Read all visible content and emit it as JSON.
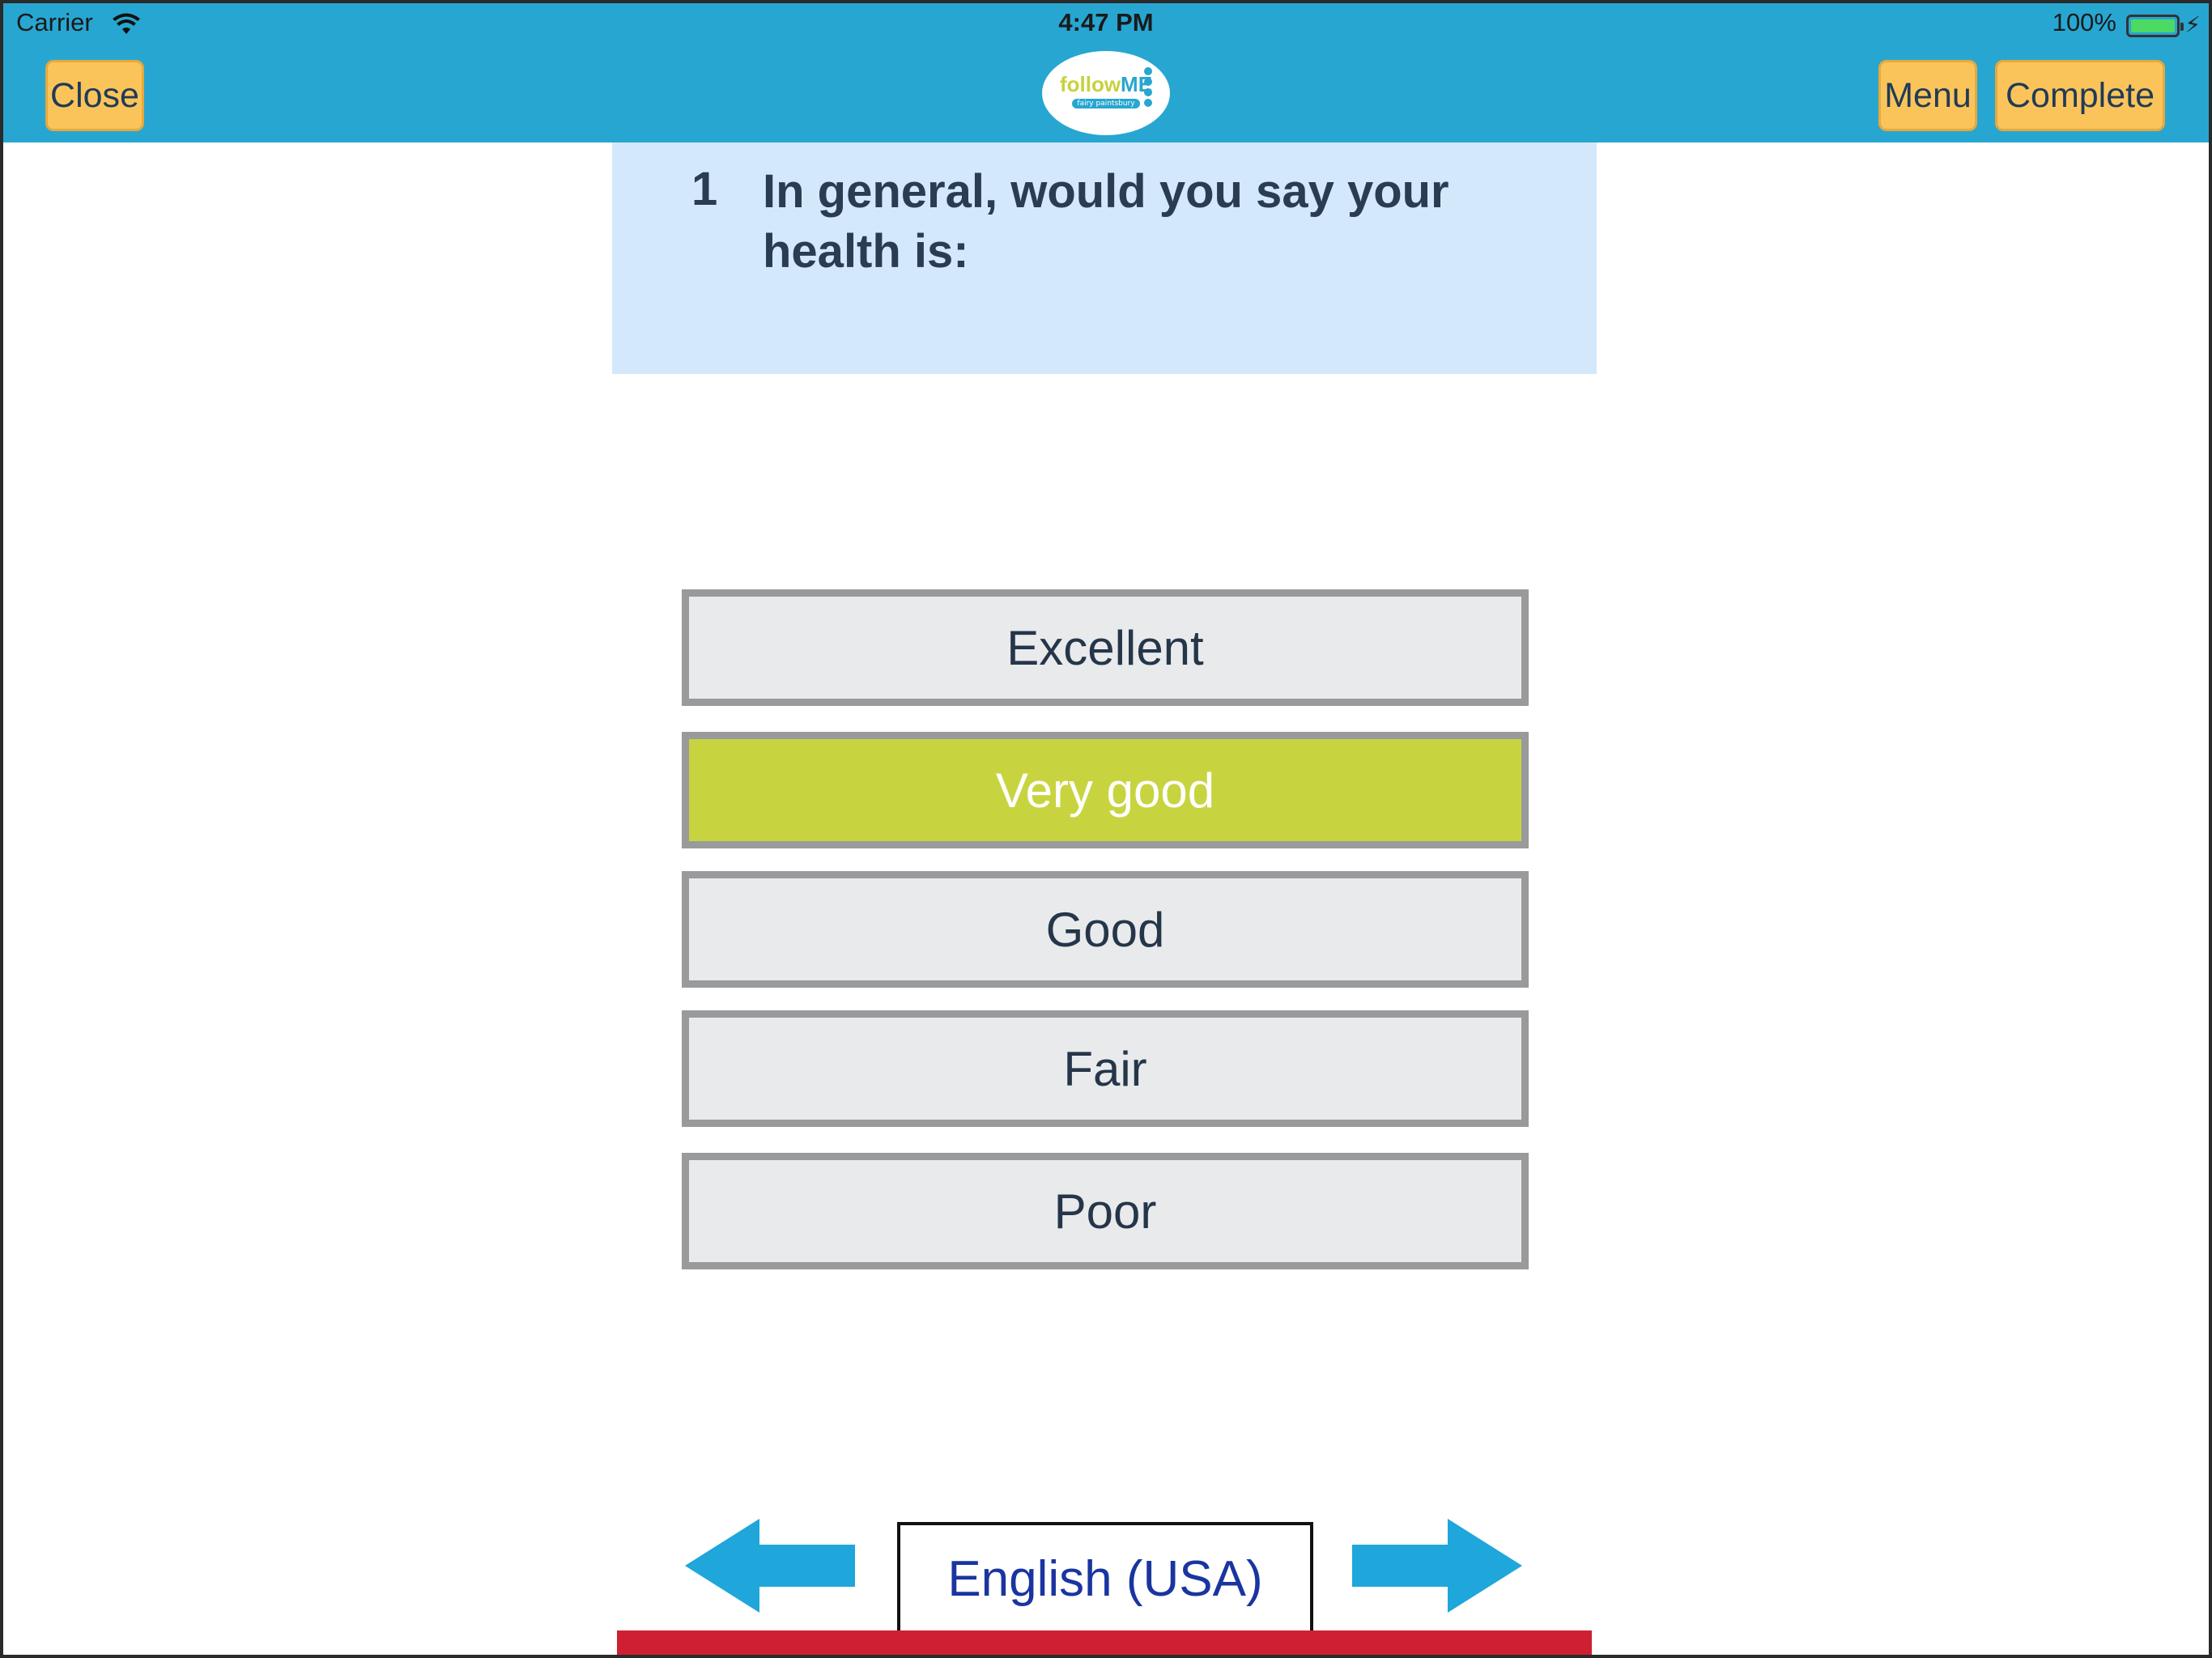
{
  "status_bar": {
    "carrier": "Carrier",
    "time": "4:47 PM",
    "battery": "100%"
  },
  "nav": {
    "close_label": "Close",
    "menu_label": "Menu",
    "complete_label": "Complete",
    "logo_text_follow": "follow",
    "logo_text_me": "ME",
    "logo_sub": "fairy paintsbury"
  },
  "question": {
    "number": "1",
    "text": "In general, would you say your health is:"
  },
  "options": [
    {
      "label": "Excellent",
      "selected": false
    },
    {
      "label": "Very good",
      "selected": true
    },
    {
      "label": "Good",
      "selected": false
    },
    {
      "label": "Fair",
      "selected": false
    },
    {
      "label": "Poor",
      "selected": false
    }
  ],
  "footer": {
    "language": "English (USA)"
  },
  "colors": {
    "topbar": "#27a6d1",
    "button": "#fbc45a",
    "question_bg": "#d3e9fb",
    "selected_option": "#c8d43f",
    "arrow": "#1fa6da",
    "footer_bar": "#cf2033"
  }
}
